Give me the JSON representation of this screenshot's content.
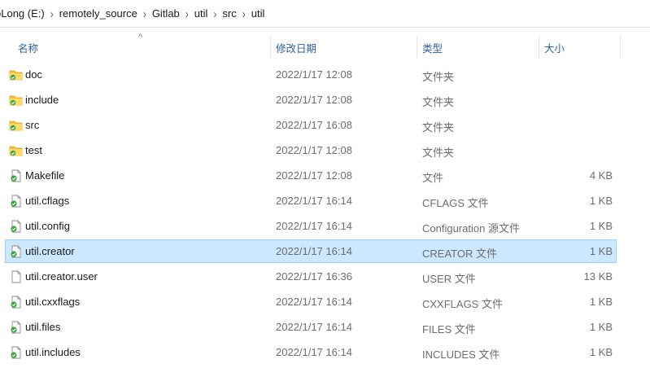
{
  "breadcrumb": [
    "oLong (E:)",
    "remotely_source",
    "Gitlab",
    "util",
    "src",
    "util"
  ],
  "columns": {
    "name": "名称",
    "date": "修改日期",
    "type": "类型",
    "size": "大小"
  },
  "files": [
    {
      "name": "doc",
      "date": "2022/1/17 12:08",
      "type": "文件夹",
      "size": "",
      "icon": "folder-icon"
    },
    {
      "name": "include",
      "date": "2022/1/17 12:08",
      "type": "文件夹",
      "size": "",
      "icon": "folder-icon"
    },
    {
      "name": "src",
      "date": "2022/1/17 16:08",
      "type": "文件夹",
      "size": "",
      "icon": "folder-icon"
    },
    {
      "name": "test",
      "date": "2022/1/17 12:08",
      "type": "文件夹",
      "size": "",
      "icon": "folder-icon"
    },
    {
      "name": "Makefile",
      "date": "2022/1/17 12:08",
      "type": "文件",
      "size": "4 KB",
      "icon": "file-green-icon"
    },
    {
      "name": "util.cflags",
      "date": "2022/1/17 16:14",
      "type": "CFLAGS 文件",
      "size": "1 KB",
      "icon": "file-green-icon"
    },
    {
      "name": "util.config",
      "date": "2022/1/17 16:14",
      "type": "Configuration 源文件",
      "size": "1 KB",
      "icon": "file-green-icon"
    },
    {
      "name": "util.creator",
      "date": "2022/1/17 16:14",
      "type": "CREATOR 文件",
      "size": "1 KB",
      "icon": "file-green-icon",
      "selected": true
    },
    {
      "name": "util.creator.user",
      "date": "2022/1/17 16:36",
      "type": "USER 文件",
      "size": "13 KB",
      "icon": "file-blank-icon"
    },
    {
      "name": "util.cxxflags",
      "date": "2022/1/17 16:14",
      "type": "CXXFLAGS 文件",
      "size": "1 KB",
      "icon": "file-green-icon"
    },
    {
      "name": "util.files",
      "date": "2022/1/17 16:14",
      "type": "FILES 文件",
      "size": "1 KB",
      "icon": "file-green-icon"
    },
    {
      "name": "util.includes",
      "date": "2022/1/17 16:14",
      "type": "INCLUDES 文件",
      "size": "1 KB",
      "icon": "file-green-icon"
    }
  ]
}
